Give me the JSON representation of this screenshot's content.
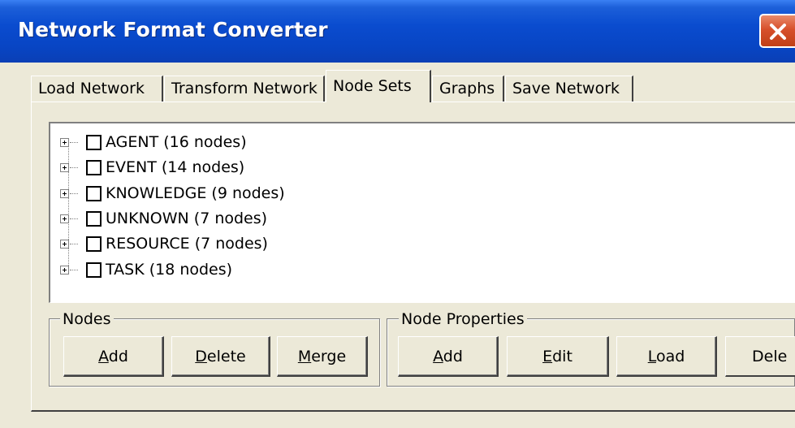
{
  "window": {
    "title": "Network Format Converter",
    "title_bar_color": "#0a4ccf",
    "close_icon": "close-icon",
    "close_color": "#d7502b"
  },
  "tabs": [
    {
      "label": "Load Network",
      "active": false
    },
    {
      "label": "Transform Network",
      "active": false
    },
    {
      "label": "Node Sets",
      "active": true
    },
    {
      "label": "Graphs",
      "active": false
    },
    {
      "label": "Save Network",
      "active": false
    }
  ],
  "tree": {
    "items": [
      {
        "label": "AGENT (16 nodes)",
        "checked": false,
        "expanded": false
      },
      {
        "label": "EVENT (14 nodes)",
        "checked": false,
        "expanded": false
      },
      {
        "label": "KNOWLEDGE (9 nodes)",
        "checked": false,
        "expanded": false
      },
      {
        "label": "UNKNOWN (7 nodes)",
        "checked": false,
        "expanded": false
      },
      {
        "label": "RESOURCE (7 nodes)",
        "checked": false,
        "expanded": false
      },
      {
        "label": "TASK (18 nodes)",
        "checked": false,
        "expanded": false
      }
    ]
  },
  "nodes_group": {
    "title": "Nodes",
    "buttons": [
      {
        "mnemonic": "A",
        "rest": "dd"
      },
      {
        "mnemonic": "D",
        "rest": "elete"
      },
      {
        "mnemonic": "M",
        "rest": "erge"
      }
    ]
  },
  "props_group": {
    "title": "Node Properties",
    "buttons": [
      {
        "mnemonic": "A",
        "rest": "dd"
      },
      {
        "mnemonic": "E",
        "rest": "dit"
      },
      {
        "mnemonic": "L",
        "rest": "oad"
      },
      {
        "mnemonic": "",
        "rest": "Dele"
      }
    ]
  }
}
